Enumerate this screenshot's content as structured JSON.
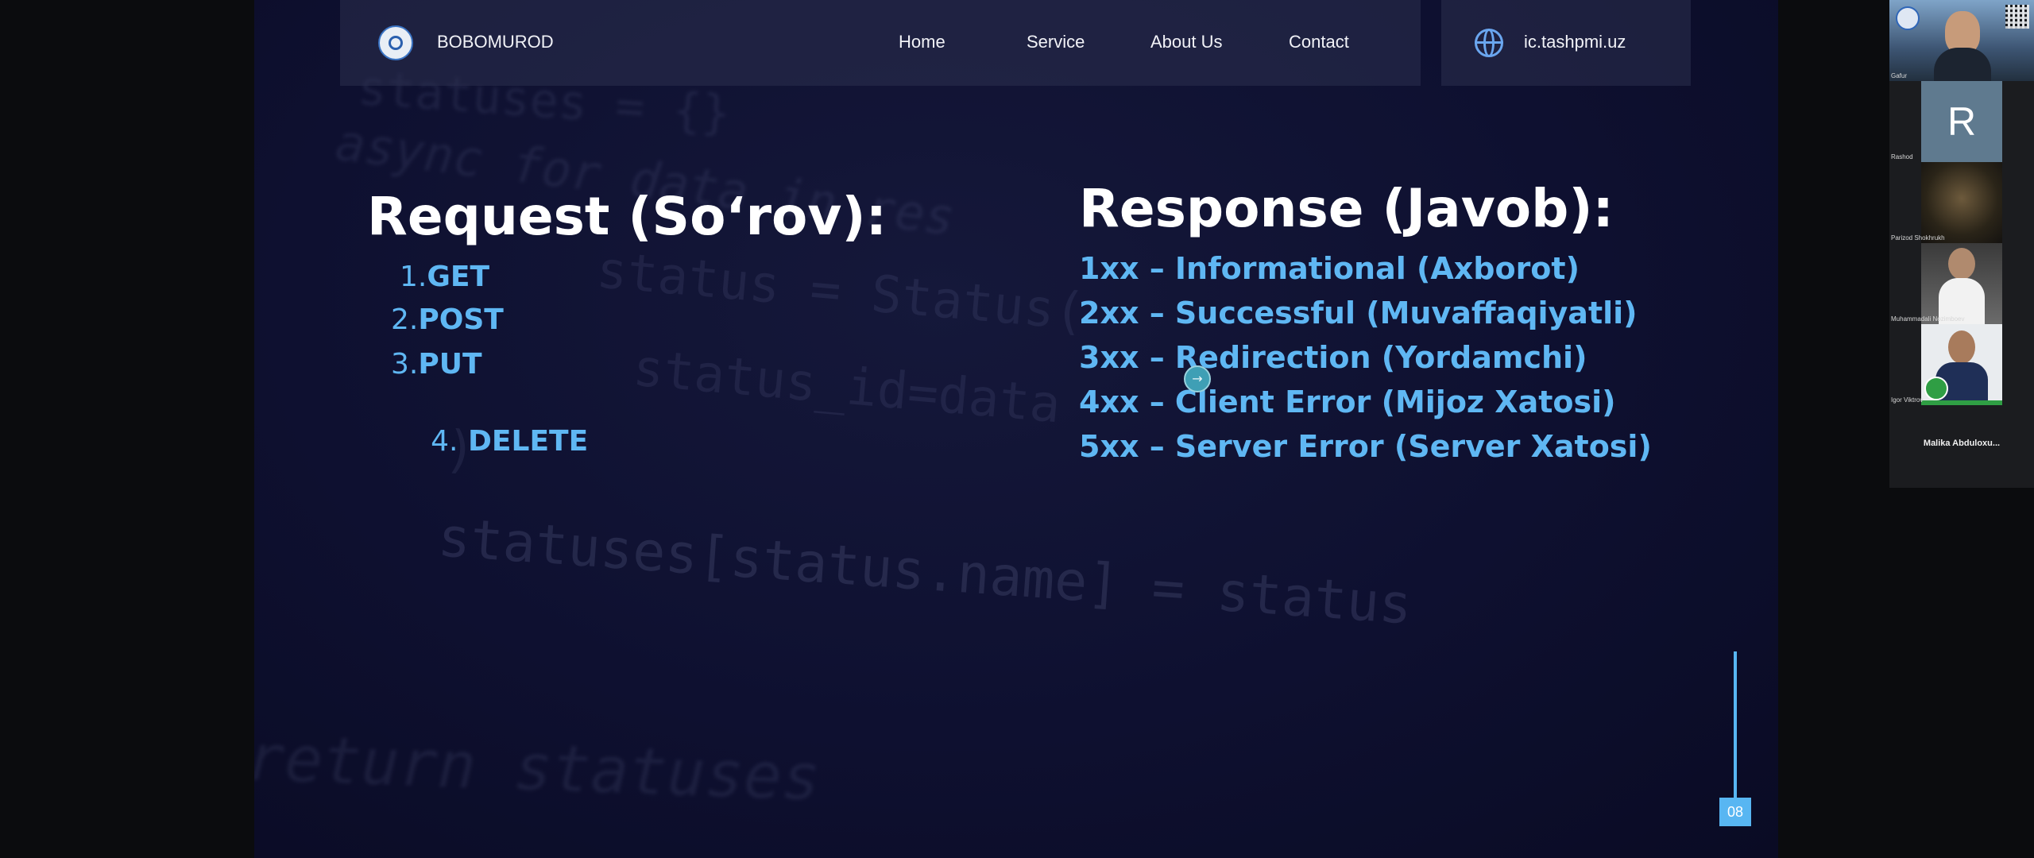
{
  "navbar": {
    "brand": "BOBOMUROD",
    "links": [
      "Home",
      "Service",
      "About Us",
      "Contact"
    ],
    "site_url": "ic.tashpmi.uz"
  },
  "slide": {
    "request_heading": "Request (So‘rov):",
    "request_items": [
      {
        "num": "1.",
        "label": "GET"
      },
      {
        "num": "2.",
        "label": "POST"
      },
      {
        "num": "3.",
        "label": "PUT"
      },
      {
        "num": "4.",
        "label": " DELETE"
      }
    ],
    "response_heading": "Response (Javob):",
    "response_items": [
      "1xx – Informational (Axborot)",
      "2xx – Successful (Muvaffaqiyatli)",
      "3xx – Redirection (Yordamchi)",
      "4xx – Client Error (Mijoz Xatosi)",
      "5xx – Server Error (Server Xatosi)"
    ],
    "page_number": "08",
    "background_code": [
      "statuses = {}",
      "async for data in res",
      "status = Status(",
      "status_id=data",
      ")",
      "statuses[status.name] = status",
      "return statuses"
    ]
  },
  "participants": {
    "tiles": [
      {
        "name": "Gafur",
        "avatar_letter": ""
      },
      {
        "name": "Rashod",
        "avatar_letter": "R"
      },
      {
        "name": "Parizod Shokhrukh",
        "avatar_letter": ""
      },
      {
        "name": "Muhammadali Nozimboev",
        "avatar_letter": ""
      },
      {
        "name": "Igor Viktrov",
        "avatar_letter": ""
      }
    ],
    "bottom_name": "Malika  Abduloxu..."
  },
  "colors": {
    "accent": "#5fb7f3",
    "slide_bg": "#0e1030",
    "navbar_bg": "#2c304e",
    "panel_bg": "#1b1c1f"
  }
}
